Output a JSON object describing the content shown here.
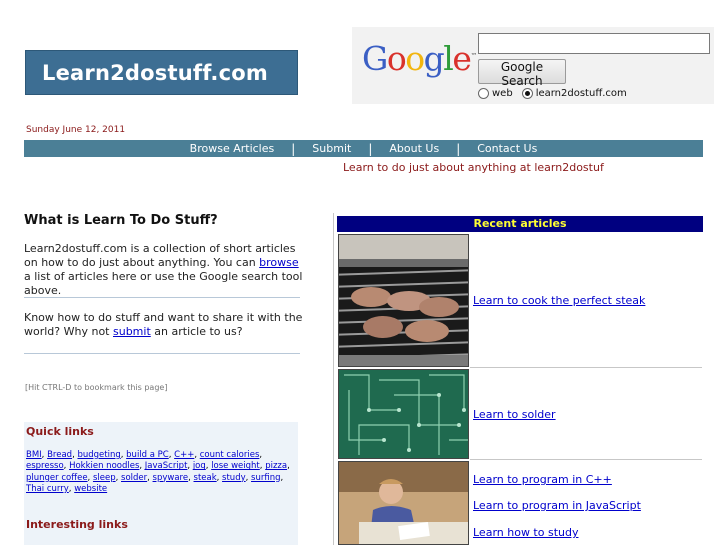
{
  "header": {
    "logo_text": "Learn2dostuff.com",
    "google_logo": "Google",
    "google_tm": "™",
    "search_value": "",
    "search_button": "Google Search",
    "radio_web": "web",
    "radio_site": "learn2dostuff.com",
    "date": "Sunday June 12, 2011"
  },
  "nav": {
    "items": [
      "Browse Articles",
      "Submit",
      "About Us",
      "Contact Us"
    ]
  },
  "tagline": "Learn to do just about anything at learn2dostuf",
  "left": {
    "heading": "What is Learn To Do Stuff?",
    "p1_before": "Learn2dostuff.com is a collection of short articles on how to do just about anything. You can ",
    "p1_link": "browse",
    "p1_after": " a list of articles here or use the Google search tool above.",
    "p2_before": "Know how to do stuff and want to share it with the world? Why not ",
    "p2_link": "submit",
    "p2_after": " an article to us?",
    "hint": "[Hit CTRL-D to bookmark this page]",
    "quick_heading": "Quick links",
    "quick_links": [
      "BMI",
      "Bread",
      "budgeting",
      "build a PC",
      "C++",
      "count calories",
      "espresso",
      "Hokkien noodles",
      "JavaScript",
      "jog",
      "lose weight",
      "pizza",
      "plunger coffee",
      "sleep",
      "solder",
      "spyware",
      "steak",
      "study",
      "surfing",
      "Thai curry",
      "website"
    ],
    "interesting_heading": "Interesting links"
  },
  "right": {
    "recent_heading": "Recent articles",
    "articles": [
      "Learn to cook the perfect steak",
      "Learn to solder",
      "Learn to program in C++",
      "Learn to program in JavaScript",
      "Learn how to study"
    ]
  },
  "colors": {
    "nav_bg": "#4b7f96",
    "logo_bg": "#3d6e93",
    "recent_bg": "#000080",
    "recent_text": "#ffff33",
    "accent_red": "#8b1a1a"
  }
}
